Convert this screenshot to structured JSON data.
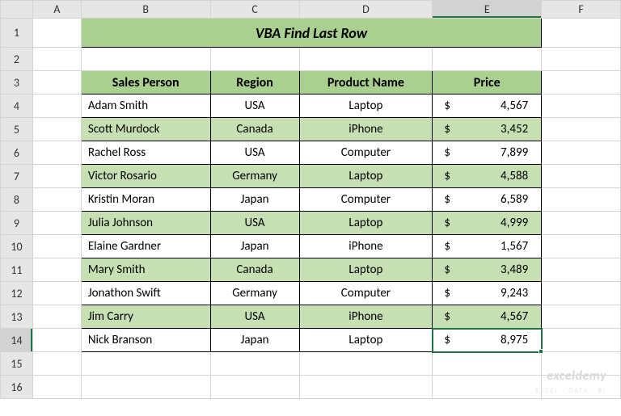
{
  "columns": [
    "A",
    "B",
    "C",
    "D",
    "E",
    "F"
  ],
  "row_count": 16,
  "selected": {
    "row": 14,
    "col": "E"
  },
  "title": "VBA Find Last Row",
  "headers": {
    "sales_person": "Sales Person",
    "region": "Region",
    "product_name": "Product Name",
    "price": "Price"
  },
  "chart_data": {
    "type": "table",
    "columns": [
      "Sales Person",
      "Region",
      "Product Name",
      "Price"
    ],
    "rows": [
      {
        "sales_person": "Adam Smith",
        "region": "USA",
        "product_name": "Laptop",
        "price": 4567,
        "price_fmt": "4,567",
        "band": false
      },
      {
        "sales_person": "Scott Murdock",
        "region": "Canada",
        "product_name": "iPhone",
        "price": 3452,
        "price_fmt": "3,452",
        "band": true
      },
      {
        "sales_person": "Rachel Ross",
        "region": "USA",
        "product_name": "Computer",
        "price": 7899,
        "price_fmt": "7,899",
        "band": false
      },
      {
        "sales_person": "Victor Rosario",
        "region": "Germany",
        "product_name": "Laptop",
        "price": 4588,
        "price_fmt": "4,588",
        "band": true
      },
      {
        "sales_person": "Kristin Moran",
        "region": "Japan",
        "product_name": "Computer",
        "price": 6589,
        "price_fmt": "6,589",
        "band": false
      },
      {
        "sales_person": "Julia Johnson",
        "region": "USA",
        "product_name": "Laptop",
        "price": 4999,
        "price_fmt": "4,999",
        "band": true
      },
      {
        "sales_person": "Elaine Gardner",
        "region": "Japan",
        "product_name": "iPhone",
        "price": 1567,
        "price_fmt": "1,567",
        "band": false
      },
      {
        "sales_person": "Mary Smith",
        "region": "Canada",
        "product_name": "Laptop",
        "price": 3489,
        "price_fmt": "3,489",
        "band": true
      },
      {
        "sales_person": "Jonathon Swift",
        "region": "Germany",
        "product_name": "Computer",
        "price": 9243,
        "price_fmt": "9,243",
        "band": false
      },
      {
        "sales_person": "Jim Carry",
        "region": "USA",
        "product_name": "iPhone",
        "price": 4567,
        "price_fmt": "4,567",
        "band": true
      },
      {
        "sales_person": "Nick Branson",
        "region": "Japan",
        "product_name": "Laptop",
        "price": 8975,
        "price_fmt": "8,975",
        "band": false
      }
    ]
  },
  "currency_symbol": "$",
  "watermark": "exceldemy",
  "watermark_sub": "EXCEL · DATA · BI"
}
